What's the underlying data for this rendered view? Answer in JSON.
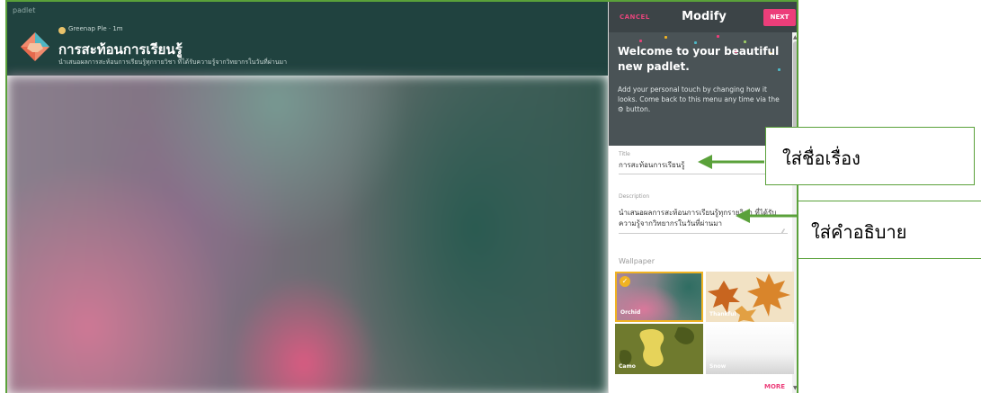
{
  "board": {
    "brand": "padlet",
    "author": "Greenap Ple",
    "time": "1m",
    "title": "การสะท้อนการเรียนรู้",
    "description": "นำเสนอผลการสะท้อนการเรียนรู้ทุกรายวิชา ที่ได้รับความรู้จากวิทยากรในวันที่ผ่านมา"
  },
  "panel": {
    "cancel_label": "CANCEL",
    "title": "Modify",
    "next_label": "NEXT",
    "welcome_title": "Welcome to your beautiful new padlet.",
    "welcome_body": "Add your personal touch by changing how it looks. Come back to this menu any time via the ⚙ button.",
    "title_label": "Title",
    "title_value": "การสะท้อนการเรียนรู้",
    "description_label": "Description",
    "description_value": "นำเสนอผลการสะท้อนการเรียนรู้ทุกรายวิชา ที่ได้รับความรู้จากวิทยากรในวันที่ผ่านมา",
    "wallpaper_label": "Wallpaper",
    "wallpapers": [
      {
        "name": "Orchid",
        "selected": true
      },
      {
        "name": "Thankful",
        "selected": false
      },
      {
        "name": "Camo",
        "selected": false
      },
      {
        "name": "Snow",
        "selected": false
      }
    ],
    "more_label": "MORE"
  },
  "annotations": {
    "title_callout": "ใส่ชื่อเรื่อง",
    "description_callout": "ใส่คำอธิบาย",
    "border_color": "#5aa13a"
  },
  "colors": {
    "header_bg": "#20423f",
    "panel_bar": "#3c4447",
    "accent_pink": "#ec3e7a",
    "selected_gold": "#f0b323"
  }
}
